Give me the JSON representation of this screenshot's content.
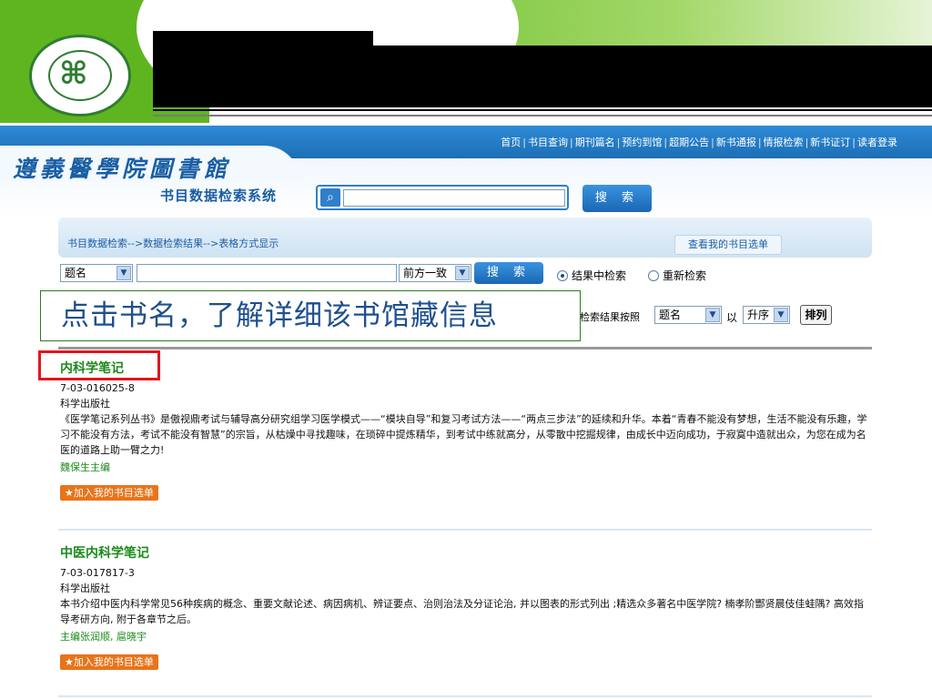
{
  "nav": {
    "links": [
      "首页",
      "书目查询",
      "期刊篇名",
      "预约到馆",
      "超期公告",
      "新书通报",
      "情报检索",
      "新书证订",
      "读者登录"
    ]
  },
  "library": {
    "title": "遵義醫學院圖書館",
    "subtitle": "书目数据检索系统",
    "search_placeholder": "",
    "search_button": "搜 索"
  },
  "breadcrumb": {
    "text": "书目数据检索-->数据检索结果-->表格方式显示",
    "my_list_button": "查看我的书目选单"
  },
  "search_row": {
    "field_select": "题名",
    "input_value": "",
    "match_select": "前方一致",
    "search_button": "搜 索",
    "radio_in_results": "结果中检索",
    "radio_new": "重新检索"
  },
  "callout": {
    "text": "点击书名，了解详细该书馆藏信息"
  },
  "sort": {
    "label": "检索结果按照",
    "field": "题名",
    "by": "以",
    "order": "升序",
    "button": "排列"
  },
  "results": [
    {
      "title": "内科学笔记",
      "isbn": "7-03-016025-8",
      "publisher": "科学出版社",
      "abstract": "《医学笔记系列丛书》是傲视鼎考试与辅导高分研究组学习医学模式——“模块自导”和复习考试方法——“两点三步法”的延续和升华。本着“青春不能没有梦想，生活不能没有乐趣，学习不能没有方法，考试不能没有智慧”的宗旨，从枯燥中寻找趣味，在琐碎中提炼精华，到考试中练就高分，从零散中挖掘规律，由成长中迈向成功，于寂寞中造就出众，为您在成为名医的道路上助一臂之力!",
      "author": "魏保生主编",
      "add_button": "★加入我的书目选单"
    },
    {
      "title": "中医内科学笔记",
      "isbn": "7-03-017817-3",
      "publisher": "科学出版社",
      "abstract": "本书介绍中医内科学常见56种疾病的概念、重要文献论述、病因病机、辨证要点、治则治法及分证论治, 并以图表的形式列出 ;精选众多著名中医学院? 楠孝阶酆贤晨伎佳蛙隅? 高效指导考研方向, 附于各章节之后。",
      "author": "主编张润顺, 扈晓宇",
      "add_button": "★加入我的书目选单"
    }
  ]
}
